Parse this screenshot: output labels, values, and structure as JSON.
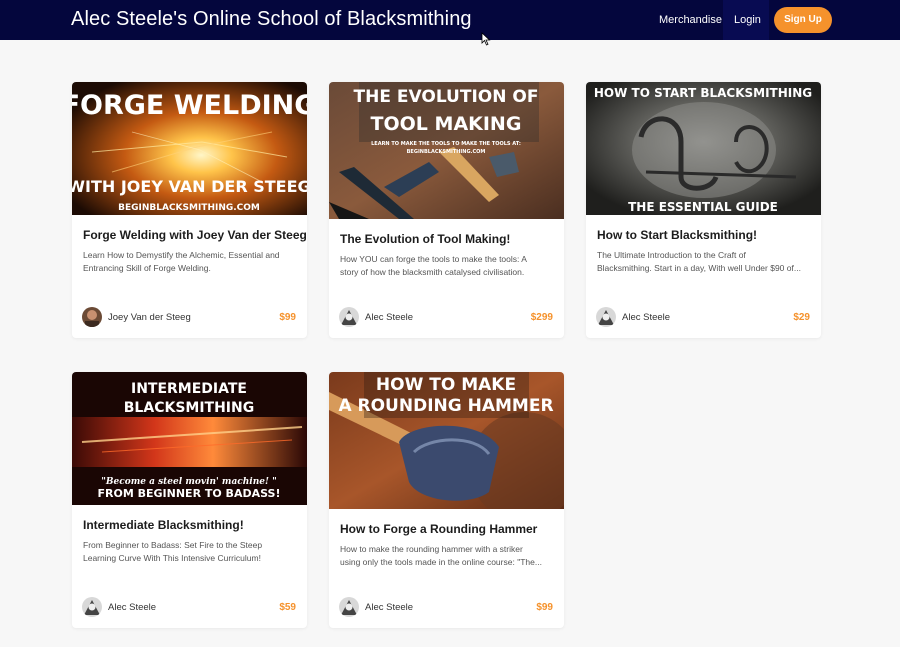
{
  "header": {
    "title": "Alec Steele's Online School of Blacksmithing",
    "nav": {
      "merchandise": "Merchandise",
      "login": "Login",
      "signup": "Sign Up"
    },
    "colors": {
      "bar": "#04063d",
      "accent": "#f5922c"
    }
  },
  "courses": [
    {
      "image_text": [
        "FORGE WELDING",
        "WITH JOEY VAN DER STEEG",
        "BEGINBLACKSMITHING.COM"
      ],
      "title": "Forge Welding with Joey Van der Steeg",
      "description": [
        "Learn How to Demystify the Alchemic, Essential and",
        "Entrancing Skill of Forge Welding."
      ],
      "author": "Joey Van der Steeg",
      "price": "$99"
    },
    {
      "image_text": [
        "THE EVOLUTION OF",
        "TOOL MAKING",
        "LEARN TO MAKE THE TOOLS TO MAKE THE TOOLS AT:",
        "BEGINBLACKSMITHING.COM"
      ],
      "title": "The Evolution of Tool Making!",
      "description": [
        "How YOU can forge the tools to make the tools: A",
        "story of how the blacksmith catalysed civilisation."
      ],
      "author": "Alec Steele",
      "price": "$299"
    },
    {
      "image_text": [
        "HOW TO START BLACKSMITHING",
        "THE ESSENTIAL GUIDE"
      ],
      "title": "How to Start Blacksmithing!",
      "description": [
        "The Ultimate Introduction to the Craft of",
        "Blacksmithing. Start in a day, With well Under $90 of..."
      ],
      "author": "Alec Steele",
      "price": "$29"
    },
    {
      "image_text": [
        "INTERMEDIATE",
        "BLACKSMITHING",
        "\"Become a steel movin' machine! \"",
        "FROM BEGINNER TO BADASS!"
      ],
      "title": "Intermediate Blacksmithing!",
      "description": [
        "From Beginner to Badass: Set Fire to the Steep",
        "Learning Curve With This Intensive Curriculum!"
      ],
      "author": "Alec Steele",
      "price": "$59"
    },
    {
      "image_text": [
        "HOW TO MAKE",
        "A ROUNDING HAMMER"
      ],
      "title": "How to Forge a Rounding Hammer",
      "description": [
        "How to make the rounding hammer with a striker",
        "using only the tools made in the online course: \"The..."
      ],
      "author": "Alec Steele",
      "price": "$99"
    }
  ]
}
